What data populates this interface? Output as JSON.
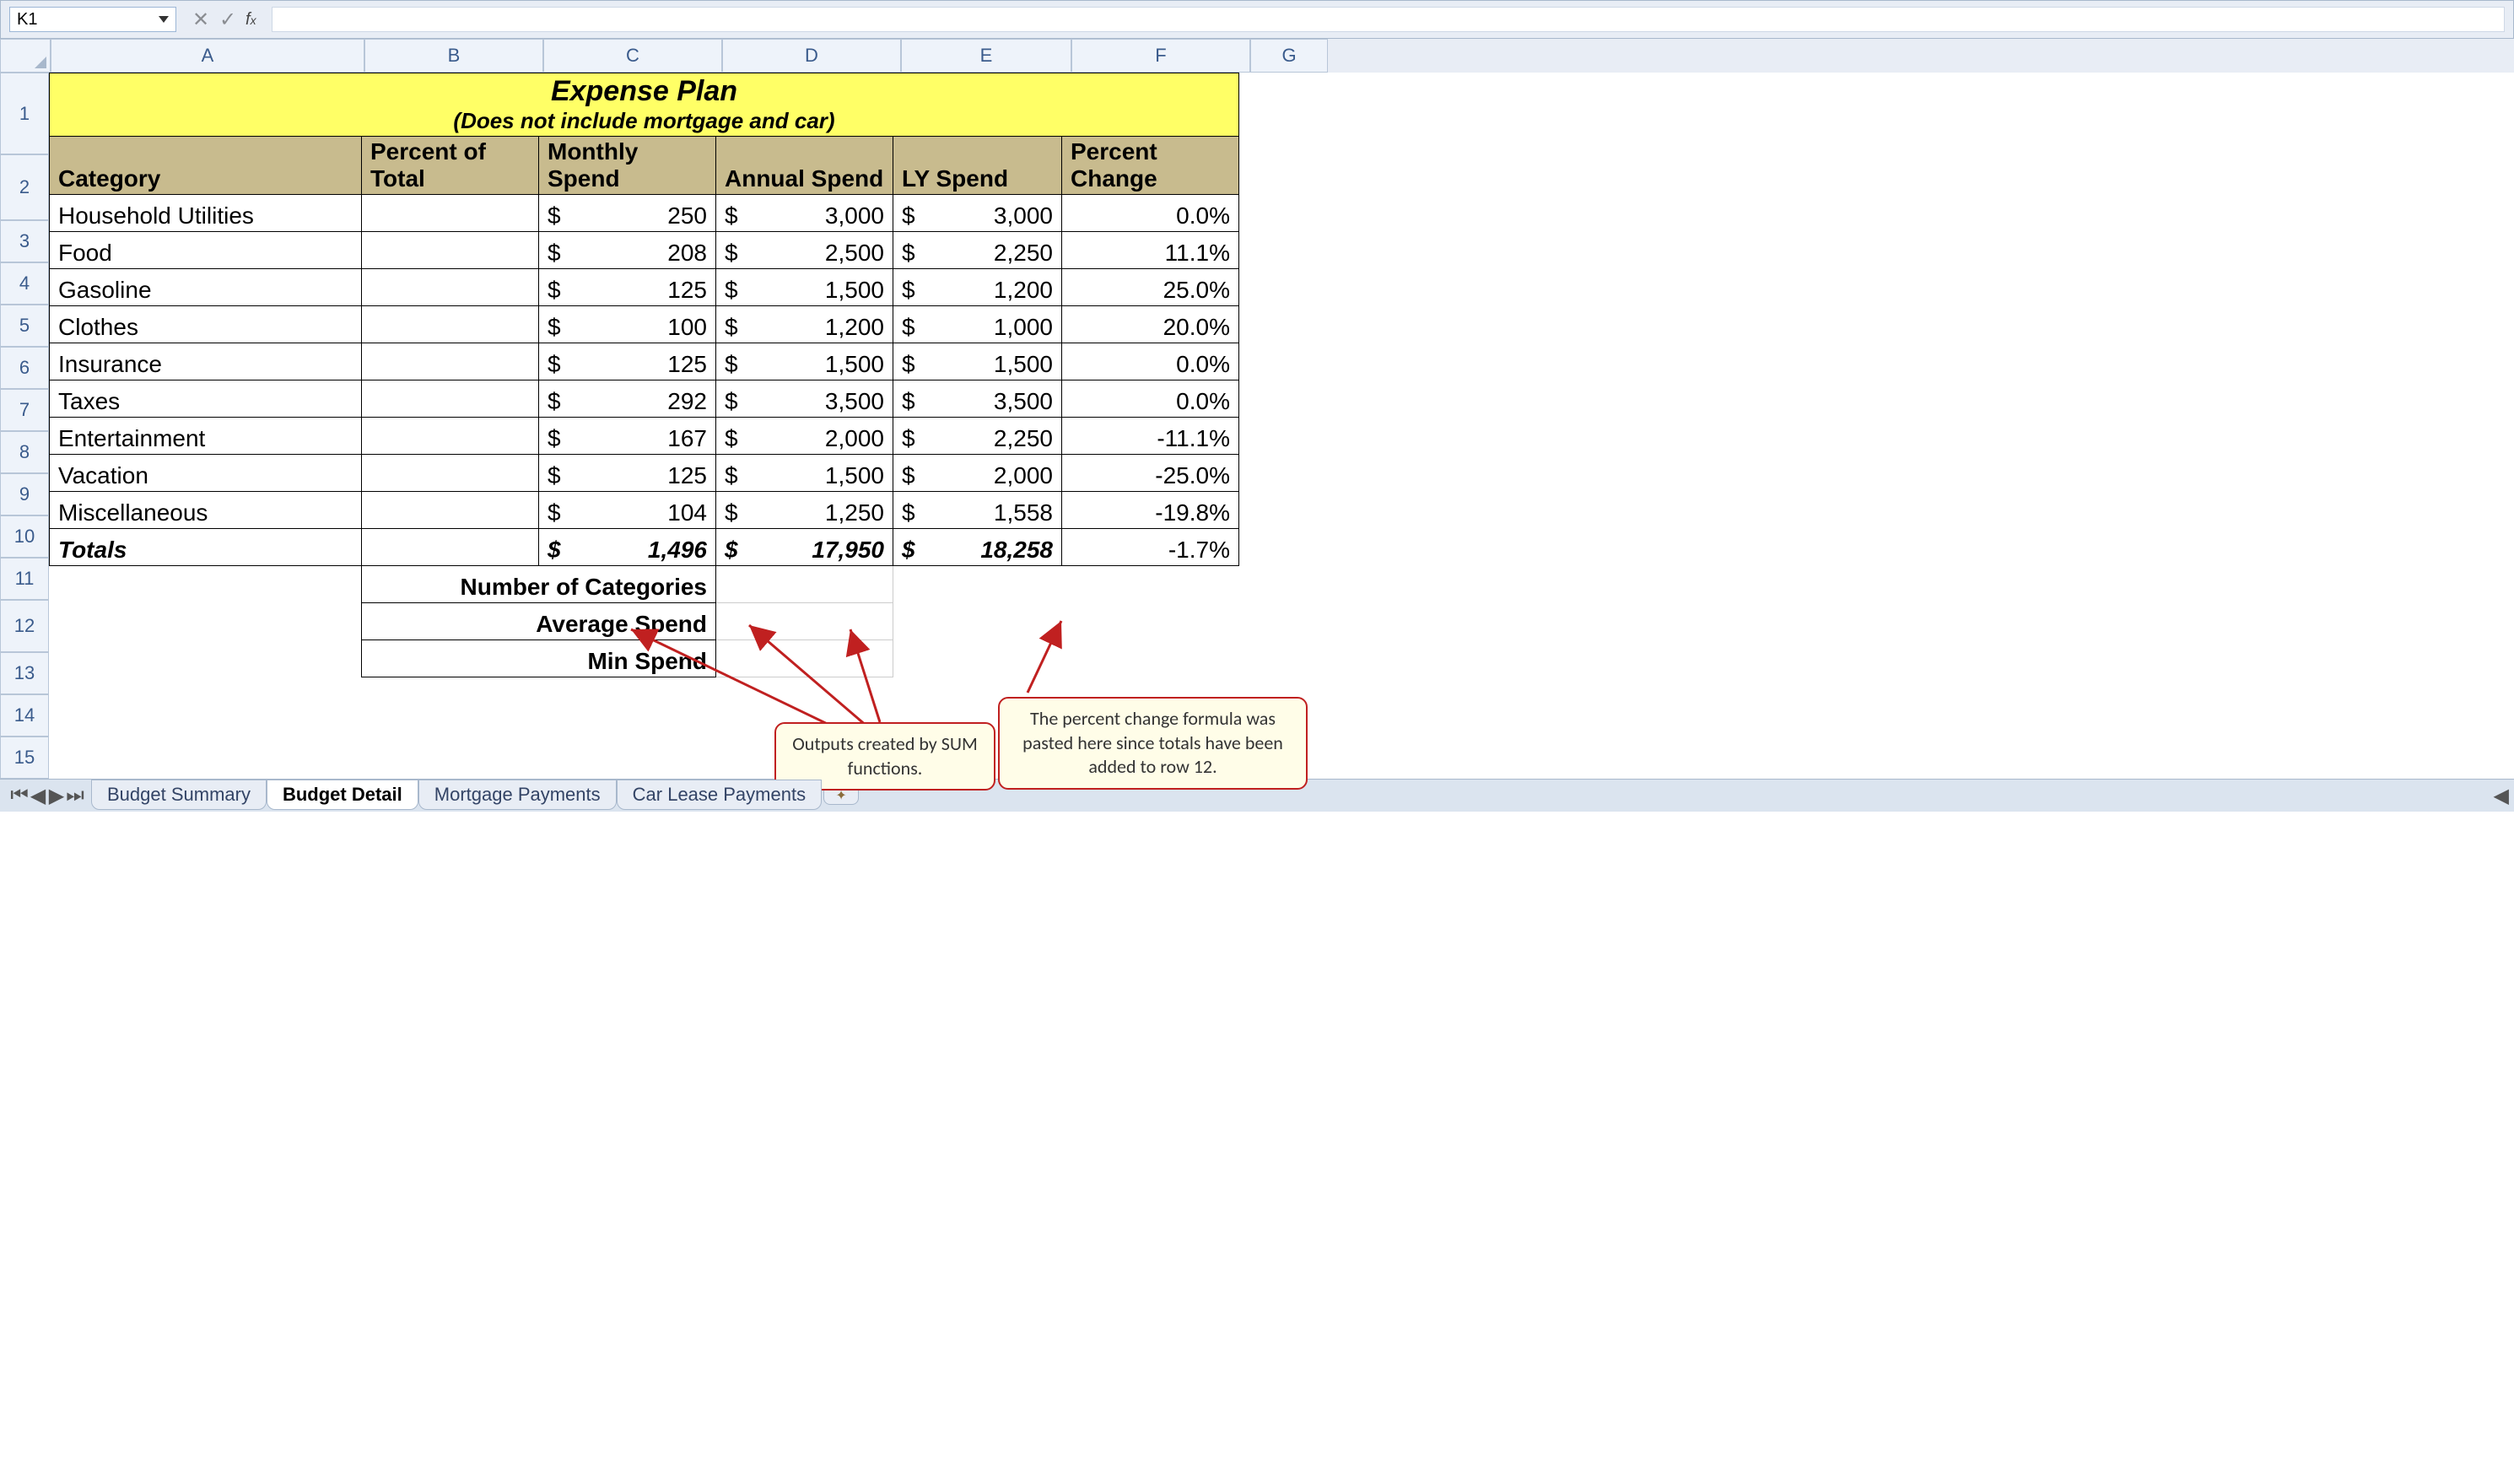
{
  "nameBox": "K1",
  "formula": "",
  "cols": [
    "A",
    "B",
    "C",
    "D",
    "E",
    "F",
    "G"
  ],
  "rows": [
    "1",
    "2",
    "3",
    "4",
    "5",
    "6",
    "7",
    "8",
    "9",
    "10",
    "11",
    "12",
    "13",
    "14",
    "15"
  ],
  "title": {
    "main": "Expense Plan",
    "sub": "(Does not include mortgage and car)"
  },
  "headers": {
    "a": "Category",
    "b": "Percent of Total",
    "c": "Monthly Spend",
    "d": "Annual Spend",
    "e": "LY Spend",
    "f": "Percent Change"
  },
  "data": [
    {
      "cat": "Household Utilities",
      "m": "250",
      "a": "3,000",
      "l": "3,000",
      "p": "0.0%"
    },
    {
      "cat": "Food",
      "m": "208",
      "a": "2,500",
      "l": "2,250",
      "p": "11.1%"
    },
    {
      "cat": "Gasoline",
      "m": "125",
      "a": "1,500",
      "l": "1,200",
      "p": "25.0%"
    },
    {
      "cat": "Clothes",
      "m": "100",
      "a": "1,200",
      "l": "1,000",
      "p": "20.0%"
    },
    {
      "cat": "Insurance",
      "m": "125",
      "a": "1,500",
      "l": "1,500",
      "p": "0.0%"
    },
    {
      "cat": "Taxes",
      "m": "292",
      "a": "3,500",
      "l": "3,500",
      "p": "0.0%"
    },
    {
      "cat": "Entertainment",
      "m": "167",
      "a": "2,000",
      "l": "2,250",
      "p": "-11.1%"
    },
    {
      "cat": "Vacation",
      "m": "125",
      "a": "1,500",
      "l": "2,000",
      "p": "-25.0%"
    },
    {
      "cat": "Miscellaneous",
      "m": "104",
      "a": "1,250",
      "l": "1,558",
      "p": "-19.8%"
    }
  ],
  "totals": {
    "label": "Totals",
    "m": "1,496",
    "a": "17,950",
    "l": "18,258",
    "p": "-1.7%"
  },
  "labels": {
    "numcat": "Number of Categories",
    "avg": "Average Spend",
    "min": "Min Spend"
  },
  "callouts": {
    "c1": "The percent change formula was pasted here since totals have been added to row 12.",
    "c2": "Outputs created by SUM functions."
  },
  "tabs": [
    "Budget Summary",
    "Budget Detail",
    "Mortgage Payments",
    "Car Lease Payments"
  ],
  "activeTab": 1,
  "chart_data": {
    "type": "table",
    "title": "Expense Plan (Does not include mortgage and car)",
    "columns": [
      "Category",
      "Monthly Spend",
      "Annual Spend",
      "LY Spend",
      "Percent Change"
    ],
    "rows": [
      [
        "Household Utilities",
        250,
        3000,
        3000,
        0.0
      ],
      [
        "Food",
        208,
        2500,
        2250,
        11.1
      ],
      [
        "Gasoline",
        125,
        1500,
        1200,
        25.0
      ],
      [
        "Clothes",
        100,
        1200,
        1000,
        20.0
      ],
      [
        "Insurance",
        125,
        1500,
        1500,
        0.0
      ],
      [
        "Taxes",
        292,
        3500,
        3500,
        0.0
      ],
      [
        "Entertainment",
        167,
        2000,
        2250,
        -11.1
      ],
      [
        "Vacation",
        125,
        1500,
        2000,
        -25.0
      ],
      [
        "Miscellaneous",
        104,
        1250,
        1558,
        -19.8
      ],
      [
        "Totals",
        1496,
        17950,
        18258,
        -1.7
      ]
    ]
  }
}
